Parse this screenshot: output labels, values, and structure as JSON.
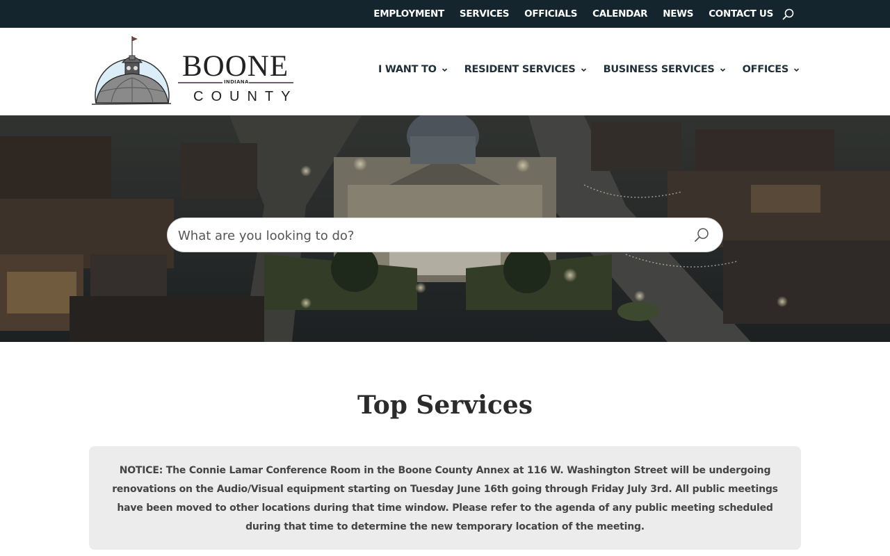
{
  "topbar": {
    "links": [
      {
        "label": "EMPLOYMENT"
      },
      {
        "label": "SERVICES"
      },
      {
        "label": "OFFICIALS"
      },
      {
        "label": "CALENDAR"
      },
      {
        "label": "NEWS"
      },
      {
        "label": "CONTACT US"
      }
    ],
    "search_icon": "search-icon",
    "bg_color": "#15252d"
  },
  "logo": {
    "word_1": "BOONE",
    "state": "INDIANA",
    "word_2": "COUNTY"
  },
  "main_nav": {
    "items": [
      {
        "label": "I WANT TO",
        "icon": "chevron-down-icon"
      },
      {
        "label": "RESIDENT SERVICES",
        "icon": "chevron-down-icon"
      },
      {
        "label": "BUSINESS SERVICES",
        "icon": "chevron-down-icon"
      },
      {
        "label": "OFFICES",
        "icon": "chevron-down-icon"
      }
    ],
    "text_color": "#1e3039"
  },
  "hero": {
    "search": {
      "placeholder": "What are you looking to do?",
      "icon": "search-icon"
    }
  },
  "content": {
    "title": "Top Services",
    "notice": "NOTICE:  The Connie Lamar Conference Room in the Boone County Annex at 116 W. Washington Street will be undergoing renovations on the Audio/Visual equipment starting on Tuesday June 16th going through Friday July 3rd.  All public meetings have been moved to other locations during that time window.  Please refer to the agenda of any public meeting scheduled during that time to determine the new temporary location of the meeting."
  }
}
